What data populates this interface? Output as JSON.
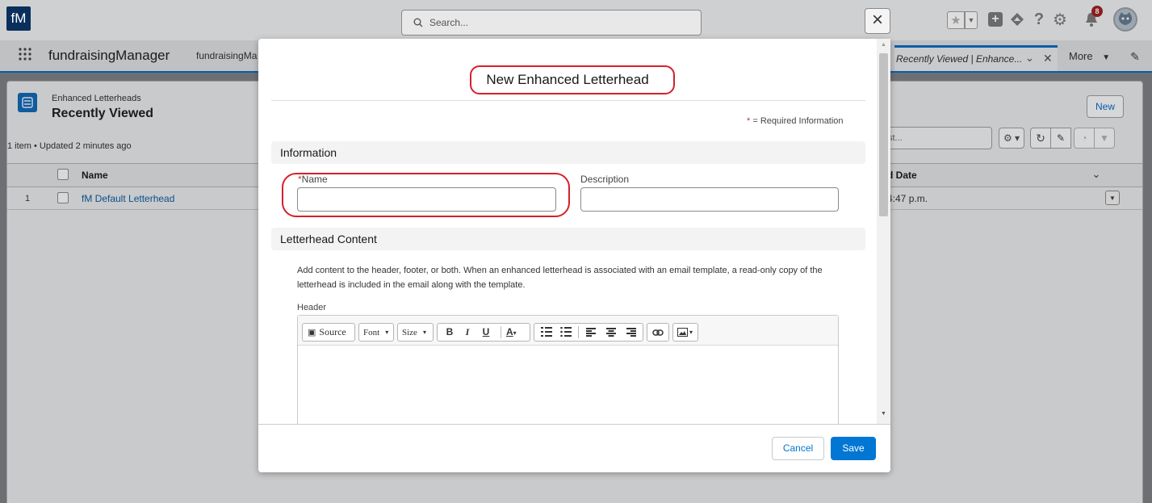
{
  "header": {
    "logo_text": "fM",
    "search_placeholder": "Search...",
    "close_symbol": "×",
    "notification_count": "8"
  },
  "nav": {
    "app_name": "fundraisingManager",
    "item_truncated": "fundraisingMa",
    "tab_label": "Recently Viewed | Enhance...",
    "more_label": "More"
  },
  "list": {
    "object_label": "Enhanced Letterheads",
    "view_name": "Recently Viewed",
    "summary": "1 item • Updated 2 minutes ago",
    "new_button": "New",
    "search_fragment": "st...",
    "col_name": "Name",
    "col_date": "d Date",
    "rows": [
      {
        "num": "1",
        "name": "fM Default Letterhead",
        "date": "4:47 p.m."
      }
    ]
  },
  "modal": {
    "title": "New Enhanced Letterhead",
    "required_star": "*",
    "required_text": "= Required Information",
    "section_information": "Information",
    "name_required": "*",
    "name_label": "Name",
    "name_value": "",
    "description_label": "Description",
    "description_value": "",
    "section_content": "Letterhead Content",
    "content_help": "Add content to the header, footer, or both. When an enhanced letterhead is associated with an email template, a read-only copy of the letterhead is included in the email along with the template.",
    "header_label": "Header",
    "toolbar": {
      "source": "Source",
      "font": "Font",
      "size": "Size",
      "bold": "B",
      "italic": "I",
      "underline": "U",
      "text_color": "A"
    },
    "cancel_button": "Cancel",
    "save_button": "Save"
  },
  "colors": {
    "brand_blue": "#0176d3",
    "annotation_red": "#d61f2c",
    "logo_navy": "#0a2f5c"
  }
}
